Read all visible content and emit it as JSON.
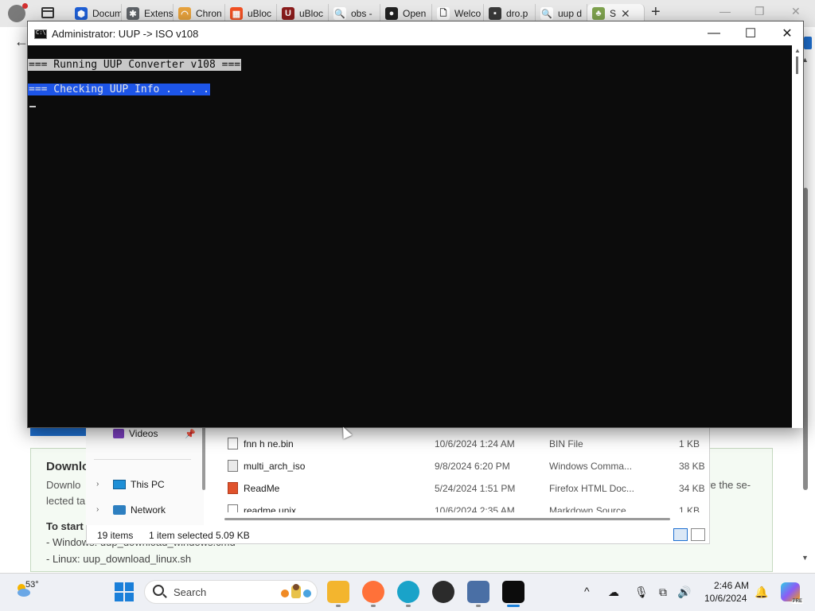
{
  "browser": {
    "tabs": [
      {
        "label": "Docum",
        "icon": "dropbox-icon",
        "color": "#1e5fd6",
        "glyph": "⬢"
      },
      {
        "label": "Extens",
        "icon": "puzzle-icon",
        "color": "#5f6368",
        "glyph": "✱"
      },
      {
        "label": "Chron",
        "icon": "rainbow-icon",
        "color": "#e8a33d",
        "glyph": "◠"
      },
      {
        "label": "uBloc",
        "icon": "windows-logo-icon",
        "color": "#f25022",
        "glyph": "▦"
      },
      {
        "label": "uBloc",
        "icon": "ublock-shield-icon",
        "color": "#8b1c1c",
        "glyph": "U"
      },
      {
        "label": "obs -",
        "icon": "search-icon",
        "color": "#ffffff",
        "glyph": "🔍"
      },
      {
        "label": "Open",
        "icon": "obs-icon",
        "color": "#222222",
        "glyph": "●"
      },
      {
        "label": "Welco",
        "icon": "document-icon",
        "color": "#ffffff",
        "glyph": "🗋"
      },
      {
        "label": "dro.p",
        "icon": "thumbnail-icon",
        "color": "#3a3a3a",
        "glyph": "▪"
      },
      {
        "label": "uup d",
        "icon": "search-icon",
        "color": "#ffffff",
        "glyph": "🔍"
      },
      {
        "label": "S",
        "icon": "site-icon",
        "color": "#7fa34f",
        "glyph": "♣",
        "active": true
      }
    ],
    "new_tab_glyph": "+"
  },
  "console": {
    "title": "Administrator:  UUP -> ISO v108",
    "line1": "=== Running UUP Converter v108 ===",
    "line2": "=== Checking UUP Info . . . .",
    "colors": {
      "background": "#0c0c0c",
      "selection": "#1d55e8",
      "highlight": "#c8c8c8"
    }
  },
  "page": {
    "card_title": "Downlo",
    "card_text1": "Downlo",
    "card_text1b": "lected ta",
    "card_right": "ve the se-",
    "card_start": "To start",
    "card_win": "- Windows: uup_download_windows.cmd",
    "card_linux": "- Linux: uup_download_linux.sh"
  },
  "explorer": {
    "nav": [
      {
        "label": "Videos",
        "icon": "videos-icon"
      },
      {
        "label": "This PC",
        "icon": "this-pc-icon"
      },
      {
        "label": "Network",
        "icon": "network-icon"
      }
    ],
    "files": [
      {
        "name": "fnn h ne.bin",
        "date": "10/6/2024 1:24 AM",
        "type": "BIN File",
        "size": "1 KB",
        "icon": "file-icon"
      },
      {
        "name": "multi_arch_iso",
        "date": "9/8/2024 6:20 PM",
        "type": "Windows Comma...",
        "size": "38 KB",
        "icon": "cmd-file-icon"
      },
      {
        "name": "ReadMe",
        "date": "5/24/2024 1:51 PM",
        "type": "Firefox HTML Doc...",
        "size": "34 KB",
        "icon": "firefox-doc-icon"
      },
      {
        "name": "readme.unix",
        "date": "10/6/2024 2:35 AM",
        "type": "Markdown Source...",
        "size": "1 KB",
        "icon": "markdown-file-icon"
      }
    ],
    "status": {
      "items": "19 items",
      "selected": "1 item selected  5.09 KB"
    }
  },
  "taskbar": {
    "weather_temp": "53°",
    "search_placeholder": "Search",
    "apps": [
      {
        "name": "file-explorer-icon",
        "color": "#f3b52e"
      },
      {
        "name": "firefox-icon",
        "color": "#ff7139"
      },
      {
        "name": "edge-icon",
        "color": "#1aa3c9"
      },
      {
        "name": "obs-studio-icon",
        "color": "#2b2b2b"
      },
      {
        "name": "network-monitor-icon",
        "color": "#4a6fa5"
      },
      {
        "name": "terminal-icon",
        "color": "#0c0c0c"
      }
    ],
    "tray": {
      "chevron": "^",
      "cloud": "☁",
      "mic": "🎙",
      "display": "⧉",
      "volume": "🔊",
      "bell": "🔔"
    },
    "time": "2:46 AM",
    "date": "10/6/2024"
  }
}
